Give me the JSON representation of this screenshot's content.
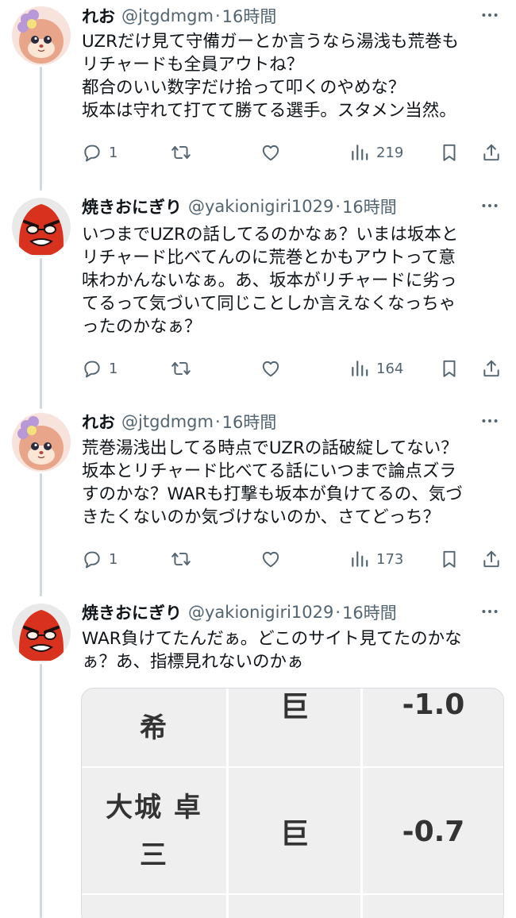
{
  "tweets": [
    {
      "name": "れお",
      "handle": "@jtgdmgm",
      "time": "16時間",
      "text": "UZRだけ見て守備ガーとか言うなら湯浅も荒巻も\nリチャードも全員アウトね？\n都合のいい数字だけ拾って叩くのやめな？\n坂本は守れて打てて勝てる選手。スタメン当然。",
      "replies": "1",
      "views": "219"
    },
    {
      "name": "焼きおにぎり",
      "handle": "@yakionigiri1029",
      "time": "16時間",
      "text": "いつまでUZRの話してるのかなぁ？いまは坂本と\nリチャード比べてんのに荒巻とかもアウトって意\n味わかんないなぁ。あ、坂本がリチャードに劣っ\nてるって気づいて同じことしか言えなくなっちゃ\nったのかなぁ？",
      "replies": "1",
      "views": "164"
    },
    {
      "name": "れお",
      "handle": "@jtgdmgm",
      "time": "16時間",
      "text": "荒巻湯浅出してる時点でUZRの話破綻してない？\n坂本とリチャード比べてる話にいつまで論点ズラ\nすのかな？WARも打撃も坂本が負けてるの、気づ\nきたくないのか気づけないのか、さてどっち？",
      "replies": "1",
      "views": "173"
    },
    {
      "name": "焼きおにぎり",
      "handle": "@yakionigiri1029",
      "time": "16時間",
      "text": "WAR負けてたんだぁ。どこのサイト見てたのかな\nぁ？あ、指標見れないのかぁ"
    }
  ],
  "separator": "·",
  "media_table": {
    "rows": [
      {
        "name": "希",
        "team": "巨",
        "war": "-1.0"
      },
      {
        "name": "大城 卓\n三",
        "team": "巨",
        "war": "-0.7"
      }
    ]
  },
  "colors": {
    "text": "#0f1419",
    "secondary": "#536471",
    "thread_line": "#cfd9de"
  },
  "icons": [
    "reply-icon",
    "retweet-icon",
    "like-icon",
    "views-icon",
    "bookmark-icon",
    "share-icon",
    "more-icon"
  ]
}
